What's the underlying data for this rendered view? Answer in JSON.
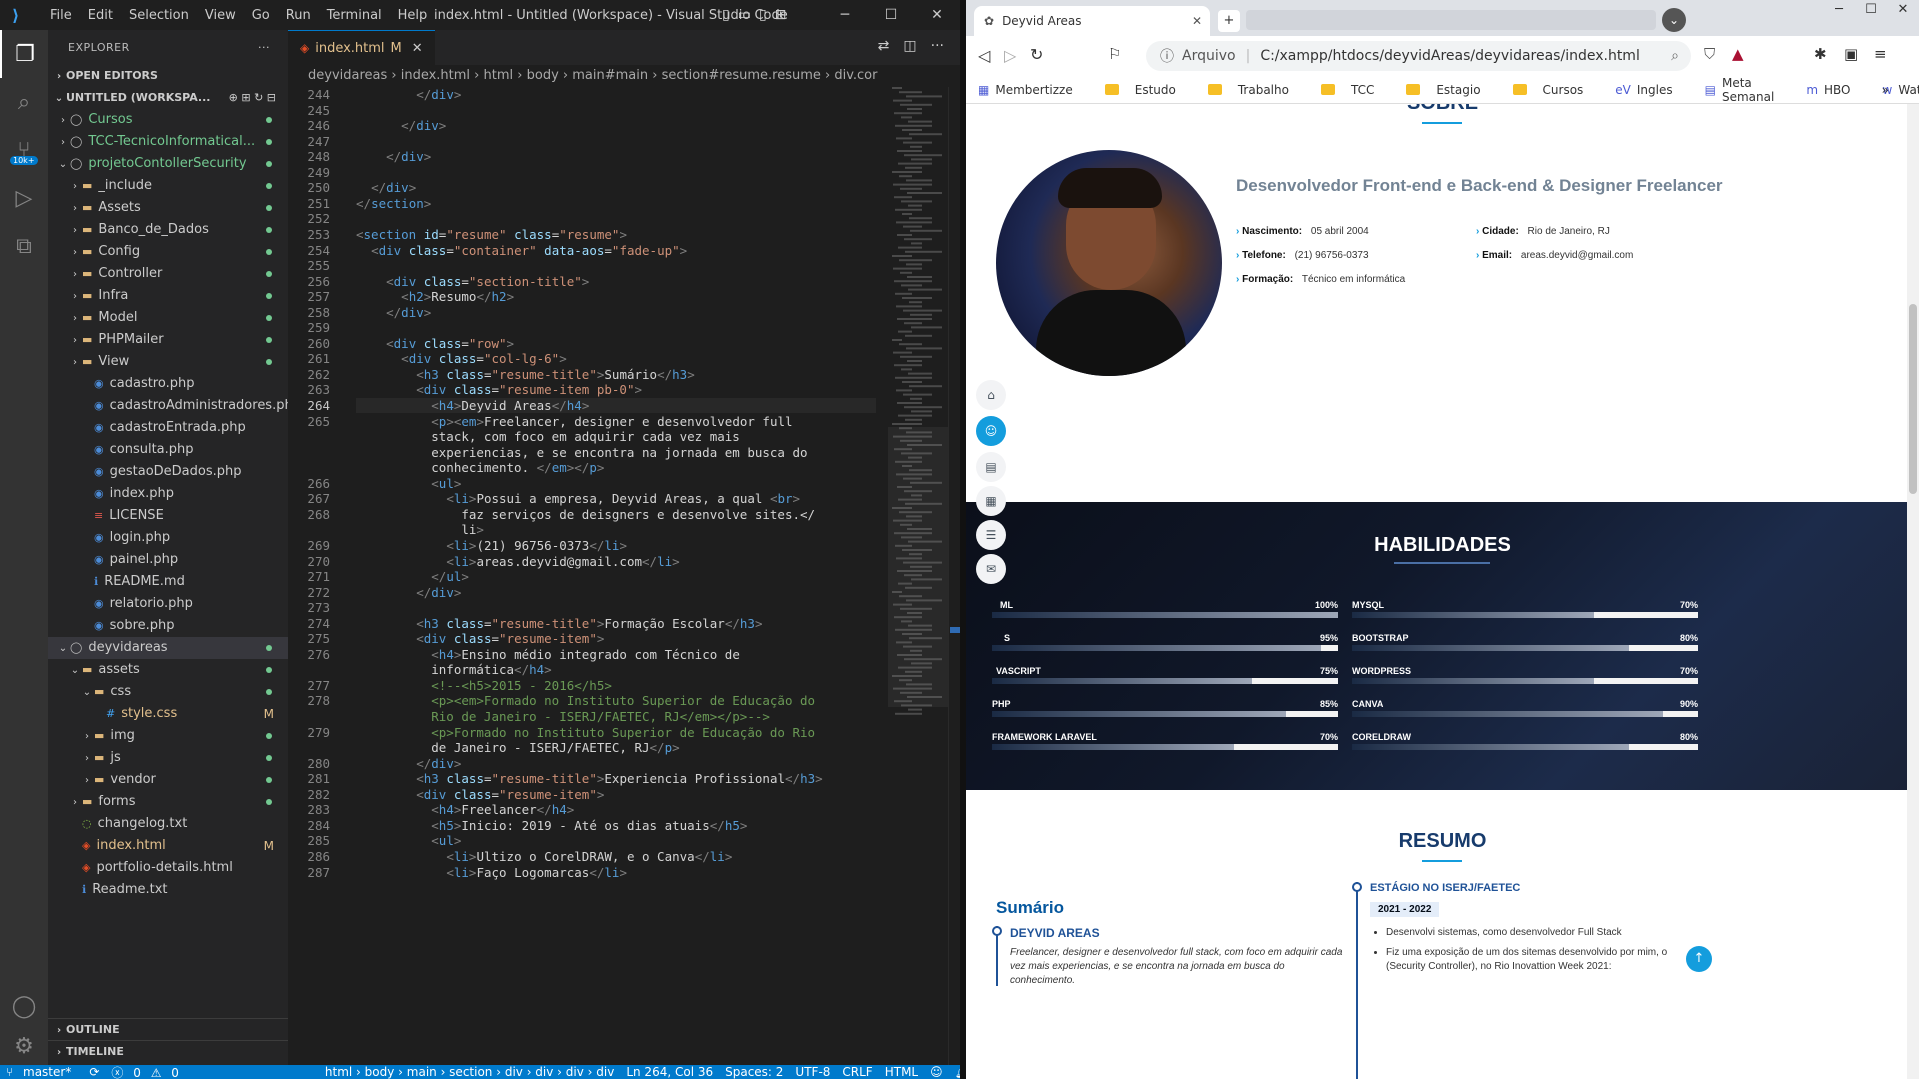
{
  "vscode": {
    "menu": [
      "File",
      "Edit",
      "Selection",
      "View",
      "Go",
      "Run",
      "Terminal",
      "Help"
    ],
    "window_title": "index.html - Untitled (Workspace) - Visual Studio Code",
    "explorer_label": "EXPLORER",
    "open_editors": "OPEN EDITORS",
    "workspace": "UNTITLED (WORKSPA...",
    "tree": [
      {
        "name": "Cursos",
        "indent": 1,
        "type": "root"
      },
      {
        "name": "TCC-TecnicoInformatical...",
        "indent": 1,
        "type": "root"
      },
      {
        "name": "projetoContollerSecurity",
        "indent": 1,
        "type": "root-open"
      },
      {
        "name": "_include",
        "indent": 2,
        "type": "folder"
      },
      {
        "name": "Assets",
        "indent": 2,
        "type": "folder"
      },
      {
        "name": "Banco_de_Dados",
        "indent": 2,
        "type": "folder"
      },
      {
        "name": "Config",
        "indent": 2,
        "type": "folder"
      },
      {
        "name": "Controller",
        "indent": 2,
        "type": "folder"
      },
      {
        "name": "Infra",
        "indent": 2,
        "type": "folder"
      },
      {
        "name": "Model",
        "indent": 2,
        "type": "folder"
      },
      {
        "name": "PHPMailer",
        "indent": 2,
        "type": "folder"
      },
      {
        "name": "View",
        "indent": 2,
        "type": "folder"
      },
      {
        "name": "cadastro.php",
        "indent": 3,
        "type": "php"
      },
      {
        "name": "cadastroAdministradores.php",
        "indent": 3,
        "type": "php"
      },
      {
        "name": "cadastroEntrada.php",
        "indent": 3,
        "type": "php"
      },
      {
        "name": "consulta.php",
        "indent": 3,
        "type": "php"
      },
      {
        "name": "gestaoDeDados.php",
        "indent": 3,
        "type": "php"
      },
      {
        "name": "index.php",
        "indent": 3,
        "type": "php"
      },
      {
        "name": "LICENSE",
        "indent": 3,
        "type": "lic"
      },
      {
        "name": "login.php",
        "indent": 3,
        "type": "php"
      },
      {
        "name": "painel.php",
        "indent": 3,
        "type": "php"
      },
      {
        "name": "README.md",
        "indent": 3,
        "type": "info"
      },
      {
        "name": "relatorio.php",
        "indent": 3,
        "type": "php"
      },
      {
        "name": "sobre.php",
        "indent": 3,
        "type": "php"
      },
      {
        "name": "deyvidareas",
        "indent": 1,
        "type": "root-open"
      },
      {
        "name": "assets",
        "indent": 2,
        "type": "folder-open"
      },
      {
        "name": "css",
        "indent": 3,
        "type": "folder-open"
      },
      {
        "name": "style.css",
        "indent": 4,
        "type": "css",
        "badge": "M"
      },
      {
        "name": "img",
        "indent": 3,
        "type": "folder"
      },
      {
        "name": "js",
        "indent": 3,
        "type": "folder"
      },
      {
        "name": "vendor",
        "indent": 3,
        "type": "folder"
      },
      {
        "name": "forms",
        "indent": 2,
        "type": "folder"
      },
      {
        "name": "changelog.txt",
        "indent": 2,
        "type": "txt"
      },
      {
        "name": "index.html",
        "indent": 2,
        "type": "html",
        "badge": "M"
      },
      {
        "name": "portfolio-details.html",
        "indent": 2,
        "type": "html"
      },
      {
        "name": "Readme.txt",
        "indent": 2,
        "type": "info"
      }
    ],
    "outline": "OUTLINE",
    "timeline": "TIMELINE",
    "tab_label": "index.html",
    "tab_badge": "M",
    "breadcrumb": [
      "deyvidareas",
      "index.html",
      "html",
      "body",
      "main#main",
      "section#resume.resume",
      "div.cor"
    ],
    "status": {
      "branch": "master*",
      "errors": "0",
      "warnings": "0",
      "path": "html › body › main › section › div › div › div › div",
      "pos": "Ln 264, Col 36",
      "spaces": "Spaces: 2",
      "enc": "UTF-8",
      "eol": "CRLF",
      "lang": "HTML"
    },
    "lines": [
      {
        "n": "244",
        "t": "        </div>"
      },
      {
        "n": "245",
        "t": ""
      },
      {
        "n": "246",
        "t": "      </div>"
      },
      {
        "n": "247",
        "t": ""
      },
      {
        "n": "248",
        "t": "    </div>"
      },
      {
        "n": "249",
        "t": ""
      },
      {
        "n": "250",
        "t": "  </div>"
      },
      {
        "n": "251",
        "t": "</section>"
      },
      {
        "n": "252",
        "t": ""
      },
      {
        "n": "253",
        "t": "<section id=\"resume\" class=\"resume\">"
      },
      {
        "n": "254",
        "t": "  <div class=\"container\" data-aos=\"fade-up\">"
      },
      {
        "n": "255",
        "t": ""
      },
      {
        "n": "256",
        "t": "    <div class=\"section-title\">"
      },
      {
        "n": "257",
        "t": "      <h2>Resumo</h2>"
      },
      {
        "n": "258",
        "t": "    </div>"
      },
      {
        "n": "259",
        "t": ""
      },
      {
        "n": "260",
        "t": "    <div class=\"row\">"
      },
      {
        "n": "261",
        "t": "      <div class=\"col-lg-6\">"
      },
      {
        "n": "262",
        "t": "        <h3 class=\"resume-title\">Sumário</h3>"
      },
      {
        "n": "263",
        "t": "        <div class=\"resume-item pb-0\">"
      },
      {
        "n": "264",
        "t": "          <h4>Deyvid Areas</h4>"
      },
      {
        "n": "265",
        "t": "          <p><em>Freelancer, designer e desenvolvedor full"
      },
      {
        "n": "",
        "t": "          stack, com foco em adquirir cada vez mais"
      },
      {
        "n": "",
        "t": "          experiencias, e se encontra na jornada em busca do"
      },
      {
        "n": "",
        "t": "          conhecimento. </em></p>"
      },
      {
        "n": "266",
        "t": "          <ul>"
      },
      {
        "n": "267",
        "t": "            <li>Possui a empresa, Deyvid Areas, a qual <br>"
      },
      {
        "n": "268",
        "t": "              faz serviços de deisgners e desenvolve sites.</"
      },
      {
        "n": "",
        "t": "              li>"
      },
      {
        "n": "269",
        "t": "            <li>(21) 96756-0373</li>"
      },
      {
        "n": "270",
        "t": "            <li>areas.deyvid@gmail.com</li>"
      },
      {
        "n": "271",
        "t": "          </ul>"
      },
      {
        "n": "272",
        "t": "        </div>"
      },
      {
        "n": "273",
        "t": ""
      },
      {
        "n": "274",
        "t": "        <h3 class=\"resume-title\">Formação Escolar</h3>"
      },
      {
        "n": "275",
        "t": "        <div class=\"resume-item\">"
      },
      {
        "n": "276",
        "t": "          <h4>Ensino médio integrado com Técnico de"
      },
      {
        "n": "",
        "t": "          informática</h4>"
      },
      {
        "n": "277",
        "t": "          <!--<h5>2015 - 2016</h5>"
      },
      {
        "n": "278",
        "t": "          <p><em>Formado no Instituto Superior de Educação do"
      },
      {
        "n": "",
        "t": "          Rio de Janeiro - ISERJ/FAETEC, RJ</em></p>-->"
      },
      {
        "n": "279",
        "t": "          <p>Formado no Instituto Superior de Educação do Rio"
      },
      {
        "n": "",
        "t": "          de Janeiro - ISERJ/FAETEC, RJ</p>"
      },
      {
        "n": "280",
        "t": "        </div>"
      },
      {
        "n": "281",
        "t": "        <h3 class=\"resume-title\">Experiencia Profissional</h3>"
      },
      {
        "n": "282",
        "t": "        <div class=\"resume-item\">"
      },
      {
        "n": "283",
        "t": "          <h4>Freelancer</h4>"
      },
      {
        "n": "284",
        "t": "          <h5>Inicio: 2019 - Até os dias atuais</h5>"
      },
      {
        "n": "285",
        "t": "          <ul>"
      },
      {
        "n": "286",
        "t": "            <li>Ultizo o CorelDRAW, e o Canva</li>"
      },
      {
        "n": "287",
        "t": "            <li>Faço Logomarcas</li>"
      }
    ]
  },
  "browser": {
    "tab_title": "Deyvid Areas",
    "address_prefix": "Arquivo",
    "address": "C:/xampp/htdocs/deyvidAreas/deyvidareas/index.html",
    "bookmarks": [
      "Membertizze",
      "Estudo",
      "Trabalho",
      "TCC",
      "Estagio",
      "Cursos",
      "Ingles",
      "Meta Semanal",
      "HBO",
      "Wattpad"
    ],
    "sobre_title": "SOBRE",
    "role": "Desenvolvedor Front-end e Back-end & Designer Freelancer",
    "info": [
      {
        "label": "Nascimento:",
        "value": "05 abril 2004"
      },
      {
        "label": "Cidade:",
        "value": "Rio de Janeiro, RJ"
      },
      {
        "label": "Telefone:",
        "value": "(21) 96756-0373"
      },
      {
        "label": "Email:",
        "value": "areas.deyvid@gmail.com"
      },
      {
        "label": "Formação:",
        "value": "Técnico em informática"
      }
    ],
    "skills_title": "HABILIDADES",
    "skills": [
      {
        "name": "HTML",
        "value": "100%",
        "pct": 1.0,
        "visible_name": "ML"
      },
      {
        "name": "MYSQL",
        "value": "70%",
        "pct": 0.7
      },
      {
        "name": "CSS",
        "value": "95%",
        "pct": 0.95,
        "visible_name": "S"
      },
      {
        "name": "BOOTSTRAP",
        "value": "80%",
        "pct": 0.8
      },
      {
        "name": "JAVASCRIPT",
        "value": "75%",
        "pct": 0.75,
        "visible_name": "VASCRIPT"
      },
      {
        "name": "WORDPRESS",
        "value": "70%",
        "pct": 0.7
      },
      {
        "name": "PHP",
        "value": "85%",
        "pct": 0.85
      },
      {
        "name": "CANVA",
        "value": "90%",
        "pct": 0.9
      },
      {
        "name": "FRAMEWORK LARAVEL",
        "value": "70%",
        "pct": 0.7
      },
      {
        "name": "CORELDRAW",
        "value": "80%",
        "pct": 0.8
      }
    ],
    "resumo_title": "RESUMO",
    "sumario": "Sumário",
    "name_heading": "DEYVID AREAS",
    "summary_text": "Freelancer, designer e desenvolvedor full stack, com foco em adquirir cada vez mais experiencias, e se encontra na jornada em busca do conhecimento.",
    "estagio_title": "ESTÁGIO NO ISERJ/FAETEC",
    "estagio_dates": "2021 - 2022",
    "estagio_items": [
      "Desenvolvi sistemas, como desenvolvedor Full Stack",
      "Fiz uma exposição de um dos sitemas desenvolvido por mim, o (Security Controller), no Rio Inovattion Week 2021:"
    ]
  }
}
